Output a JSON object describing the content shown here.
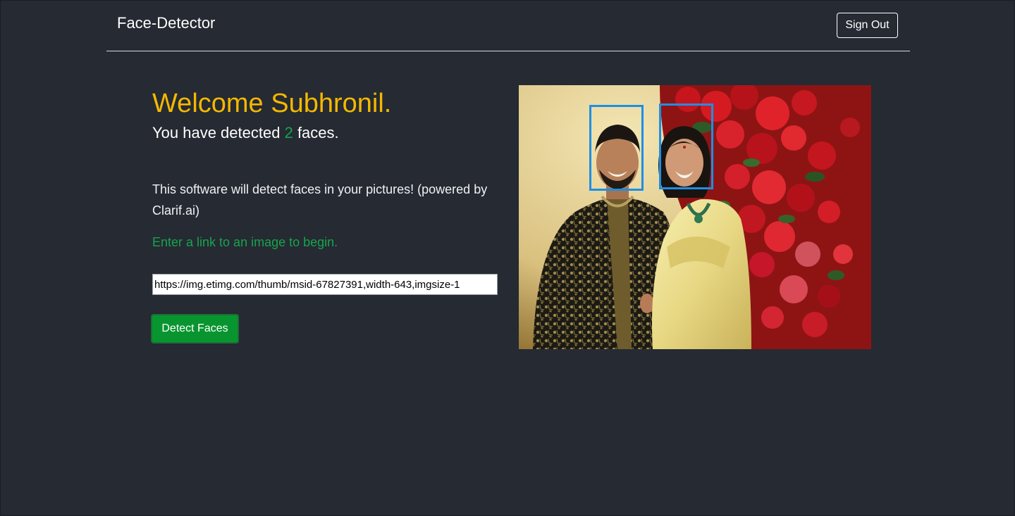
{
  "app": {
    "brand": "Face-Detector",
    "sign_out_label": "Sign Out"
  },
  "main": {
    "welcome": "Welcome Subhronil.",
    "detected_prefix": "You have detected ",
    "detected_count": "2",
    "detected_suffix": " faces.",
    "description": "This software will detect faces in your pictures! (powered by Clarif.ai)",
    "hint": "Enter a link to an image to begin.",
    "url_value": "https://img.etimg.com/thumb/msid-67827391,width-643,imgsize-1",
    "detect_button_label": "Detect Faces"
  },
  "colors": {
    "background": "#252a33",
    "welcome": "#f5b800",
    "accent_green": "#17a44b",
    "button_green": "#08952f",
    "face_box": "#1d8fe6"
  }
}
